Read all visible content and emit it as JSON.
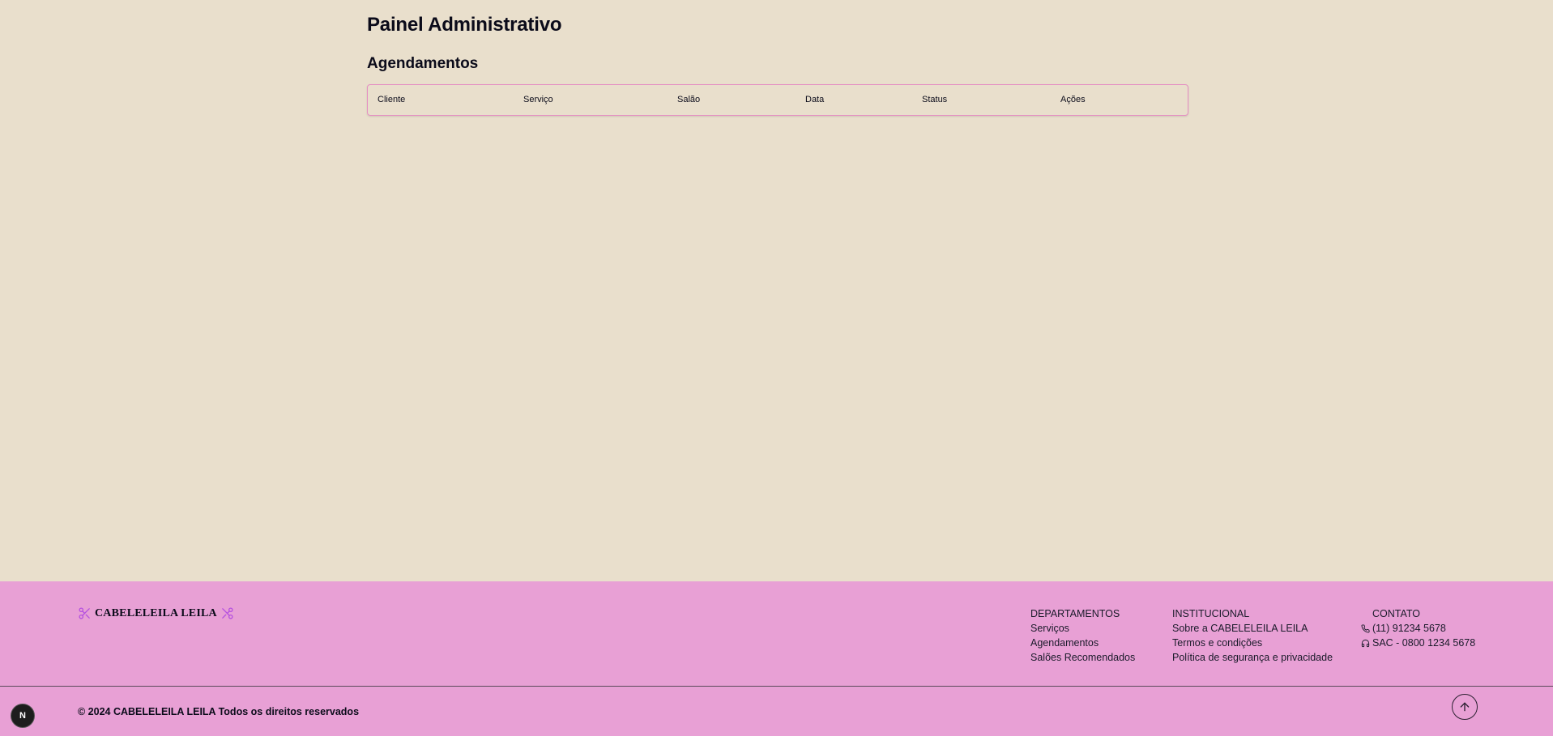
{
  "page": {
    "title": "Painel Administrativo",
    "section_title": "Agendamentos"
  },
  "table": {
    "columns": [
      "Cliente",
      "Serviço",
      "Salão",
      "Data",
      "Status",
      "Ações"
    ],
    "rows": []
  },
  "footer": {
    "brand": "CABELELEILA LEILA",
    "departamentos": {
      "heading": "DEPARTAMENTOS",
      "links": [
        "Serviços",
        "Agendamentos",
        "Salões Recomendados"
      ]
    },
    "institucional": {
      "heading": "INSTITUCIONAL",
      "links": [
        "Sobre a CABELELEILA LEILA",
        "Termos e condições",
        "Política de segurança e privacidade"
      ]
    },
    "contato": {
      "heading": "CONTATO",
      "phone": "(11) 91234 5678",
      "sac": "SAC - 0800 1234 5678"
    },
    "copyright": "© 2024 CABELELEILA LEILA Todos os direitos reservados"
  },
  "dev_badge": "N",
  "colors": {
    "background": "#e9dfcc",
    "footer": "#e8a0d5",
    "table_border": "#e58fc3",
    "icon_accent": "#b44fe0"
  },
  "icons": [
    "scissors-icon",
    "phone-icon",
    "headset-icon",
    "arrow-up-icon"
  ]
}
